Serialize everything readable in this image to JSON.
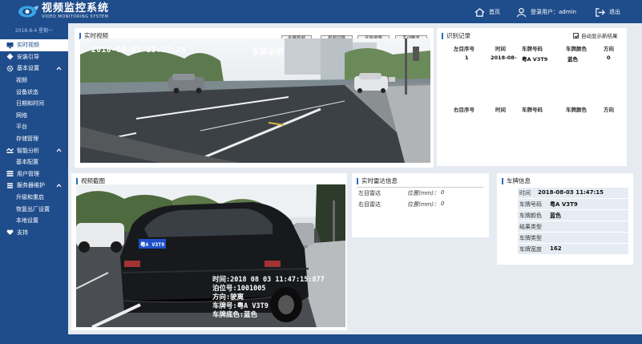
{
  "header": {
    "title": "视频监控系统",
    "subtitle": "VIDEO MONITORING SYSTEM",
    "home_label": "首页",
    "user_label": "登录用户：admin",
    "logout_label": "退出"
  },
  "sidebar": {
    "date": "2018-8-4 星期一",
    "items": [
      {
        "label": "实时视频",
        "icon": "monitor-icon"
      },
      {
        "label": "安装引导",
        "icon": "guide-icon"
      },
      {
        "label": "基本设置",
        "icon": "gear-icon"
      },
      {
        "label": "视频"
      },
      {
        "label": "设备状态"
      },
      {
        "label": "日期和时间"
      },
      {
        "label": "网络"
      },
      {
        "label": "平台"
      },
      {
        "label": "存储管理"
      },
      {
        "label": "智能分析",
        "icon": "analysis-icon"
      },
      {
        "label": "基本配置"
      },
      {
        "label": "用户管理",
        "icon": "users-icon"
      },
      {
        "label": "服务器维护",
        "icon": "server-icon"
      },
      {
        "label": "升级和重启"
      },
      {
        "label": "恢复出厂设置"
      },
      {
        "label": "本地设置"
      },
      {
        "label": "支持",
        "icon": "heart-icon"
      }
    ]
  },
  "live_video": {
    "title": "实时视频",
    "buttons": [
      "全屏视频",
      "视频切换",
      "开始录像",
      "手动触发"
    ],
    "timestamp": "2018-08-03  13:23:24",
    "overlay_text": "车牌识别"
  },
  "records": {
    "title": "识别记录",
    "auto_show_label": "自动显示新结果",
    "auto_show_checked": true,
    "columns_left": [
      "左目序号",
      "时间",
      "车牌号码",
      "车牌颜色",
      "方向"
    ],
    "rows_left": [
      [
        "1",
        "2018-08-",
        "粤A V3T9",
        "蓝色",
        "0"
      ]
    ],
    "columns_right": [
      "右目序号",
      "时间",
      "车牌号码",
      "车牌颜色",
      "方向"
    ]
  },
  "snapshot": {
    "title": "视频截图",
    "plate_tag": "粤A V3T9",
    "overlay_lines": [
      "时间:2018 08 03 11:47:15:877",
      "泊位号:1001005",
      "方向:驶离",
      "车牌号:粤A V3T9",
      "车牌底色:蓝色"
    ]
  },
  "radar": {
    "title": "实时雷达信息",
    "left_label": "左目雷达",
    "right_label": "右目雷达",
    "pos_label": "位置(mm)：",
    "left_value": "0",
    "right_value": "0"
  },
  "plate_info": {
    "title": "车牌信息",
    "rows": [
      {
        "label": "时间",
        "value": "2018-08-03 11:47:15"
      },
      {
        "label": "车牌号码",
        "value": "粤A V3T9"
      },
      {
        "label": "车牌颜色",
        "value": "蓝色"
      },
      {
        "label": "结果类型",
        "value": ""
      },
      {
        "label": "车牌类型",
        "value": ""
      },
      {
        "label": "车牌宽度",
        "value": "162"
      }
    ]
  },
  "colors": {
    "brand": "#1f4d8c",
    "accent": "#2a6cc4",
    "plate_blue": "#1e50c8"
  }
}
